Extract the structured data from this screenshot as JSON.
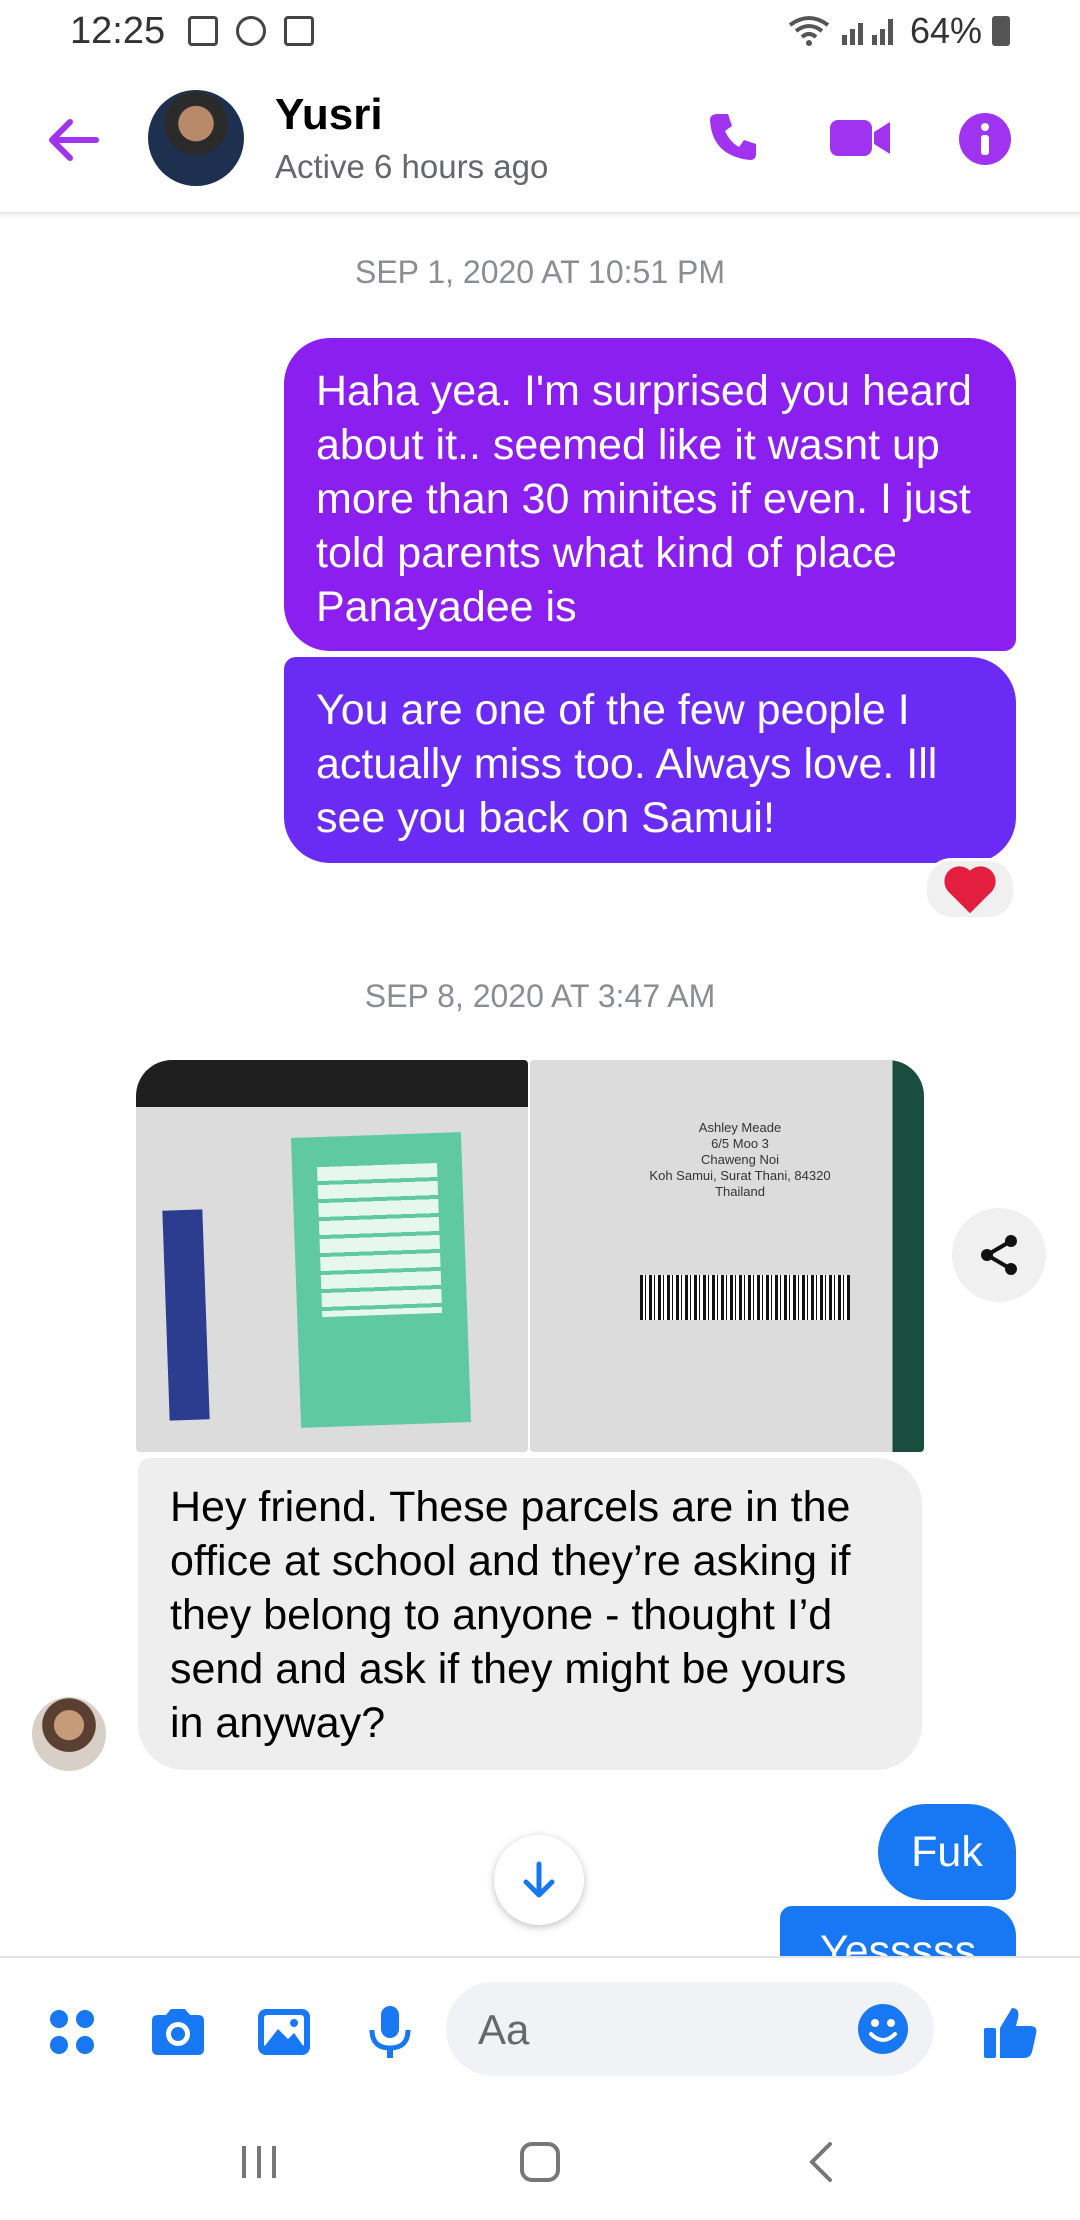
{
  "status_bar": {
    "time": "12:25",
    "battery": "64%"
  },
  "header": {
    "name": "Yusri",
    "status": "Active 6 hours ago"
  },
  "colors": {
    "accent_purple": "#a033f0",
    "messenger_blue": "#1878f3",
    "bubble_purple_1": "#8b1ff0",
    "bubble_purple_2": "#6a2cf5"
  },
  "messages": {
    "stamp1": "SEP 1, 2020 AT 10:51 PM",
    "out1": "Haha yea. I'm surprised you heard about it.. seemed like it wasnt up more than 30 minites if even. I just told parents what kind of place Panayadee is",
    "out2": "You are one of the few people I actually miss too. Always love. Ill see you back on Samui!",
    "stamp2": "SEP 8, 2020 AT 3:47 AM",
    "in1": "Hey friend. These parcels are in the office at school and they’re asking if they belong to anyone - thought I’d send and ask if they might be yours in anyway?",
    "out3": "Fuk",
    "out4": "Yesssss"
  },
  "photo2_address": {
    "line1": "Ashley Meade",
    "line2": "6/5 Moo 3",
    "line3": "Chaweng Noi",
    "line4": "Koh Samui, Surat Thani, 84320",
    "line5": "Thailand"
  },
  "composer": {
    "placeholder": "Aa"
  }
}
